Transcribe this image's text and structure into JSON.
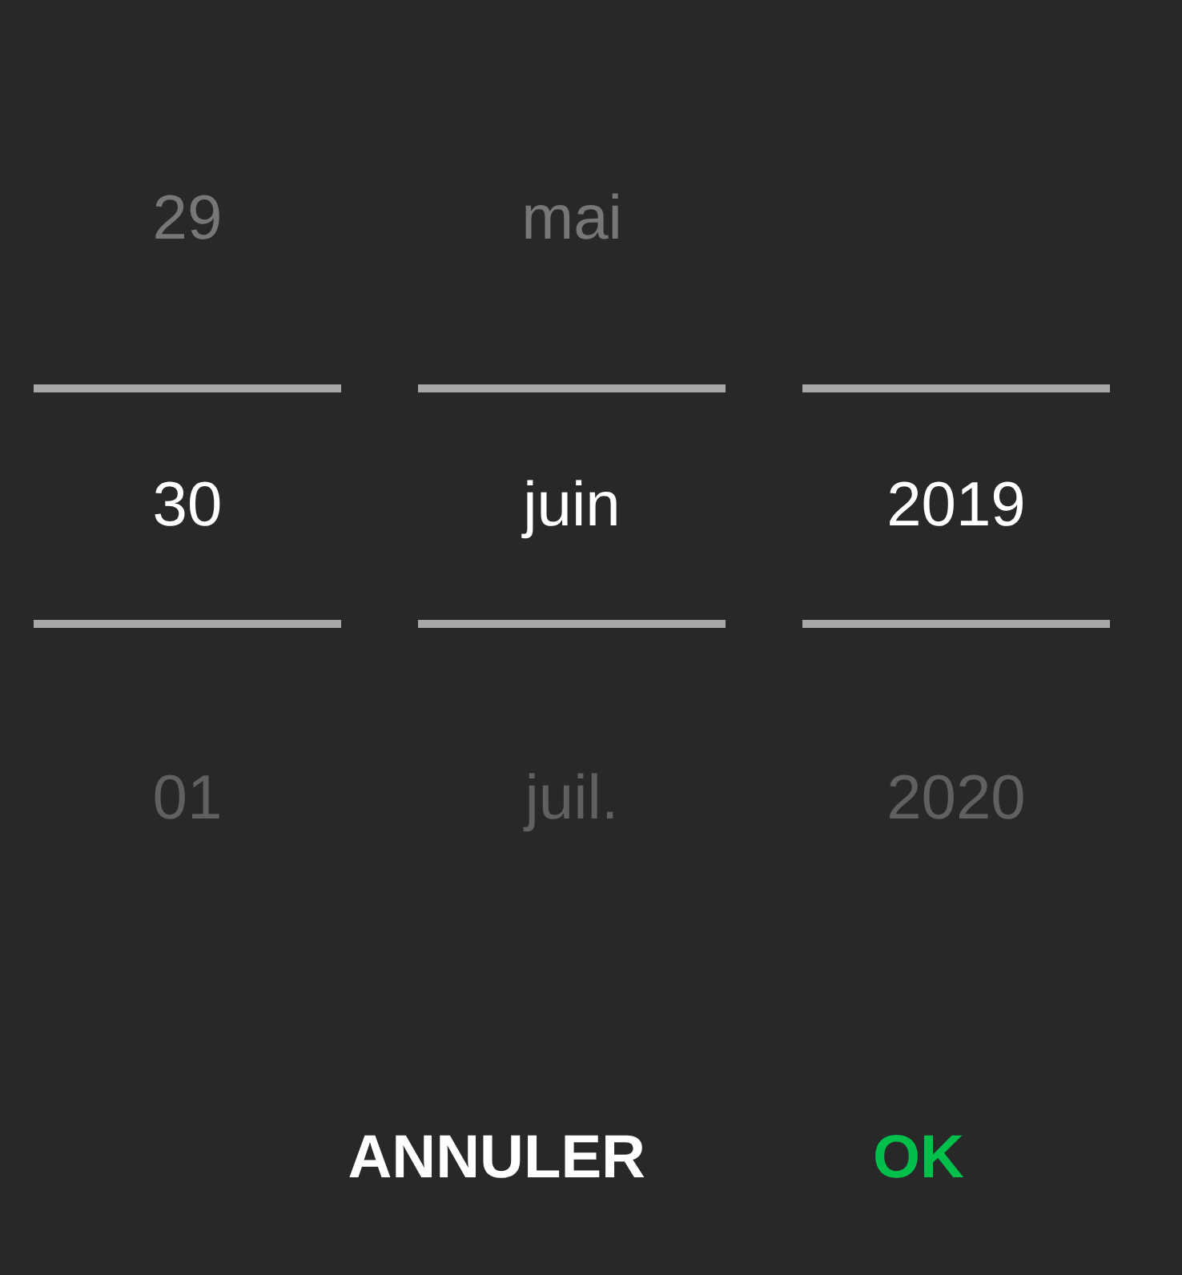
{
  "columns": [
    {
      "items": [
        {
          "label": "29",
          "selected": false
        },
        {
          "label": "30",
          "selected": true
        },
        {
          "label": "01",
          "selected": false
        }
      ]
    },
    {
      "items": [
        {
          "label": "mai",
          "selected": false
        },
        {
          "label": "juin",
          "selected": true
        },
        {
          "label": "juil.",
          "selected": false
        }
      ]
    },
    {
      "items": [
        {
          "label": "2019",
          "selected": true
        },
        {
          "label": "2020",
          "selected": false
        }
      ]
    }
  ],
  "buttons": [
    {
      "label": "ANNULER",
      "kind": "cancel"
    },
    {
      "label": "OK",
      "kind": "confirm"
    }
  ]
}
